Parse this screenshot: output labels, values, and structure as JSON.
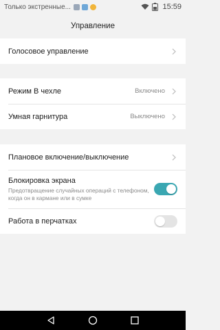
{
  "status_bar": {
    "carrier": "Только экстренные...",
    "notification_icons": [
      "document-icon",
      "message-icon",
      "notification-dot-icon"
    ],
    "wifi_icon": "wifi-icon",
    "battery_icon": "battery-icon",
    "time": "15:59"
  },
  "appbar": {
    "title": "Управление"
  },
  "group1": {
    "voice": {
      "label": "Голосовое управление"
    }
  },
  "group2": {
    "case_mode": {
      "label": "Режим В чехле",
      "value": "Включено"
    },
    "smart_headset": {
      "label": "Умная гарнитура",
      "value": "Выключено"
    }
  },
  "group3": {
    "scheduled_power": {
      "label": "Плановое включение/выключение"
    },
    "screen_lock": {
      "label": "Блокировка экрана",
      "description": "Предотвращение случайных операций с телефоном, когда он в кармане или в сумке",
      "enabled": true
    },
    "glove_mode": {
      "label": "Работа в перчатках",
      "enabled": false
    }
  },
  "navigation": {
    "back_icon": "back-icon",
    "home_icon": "home-icon",
    "recents_icon": "recents-icon"
  },
  "colors": {
    "accent": "#3aa7b2",
    "background": "#f2f2f2",
    "nav_bar": "#000000"
  }
}
